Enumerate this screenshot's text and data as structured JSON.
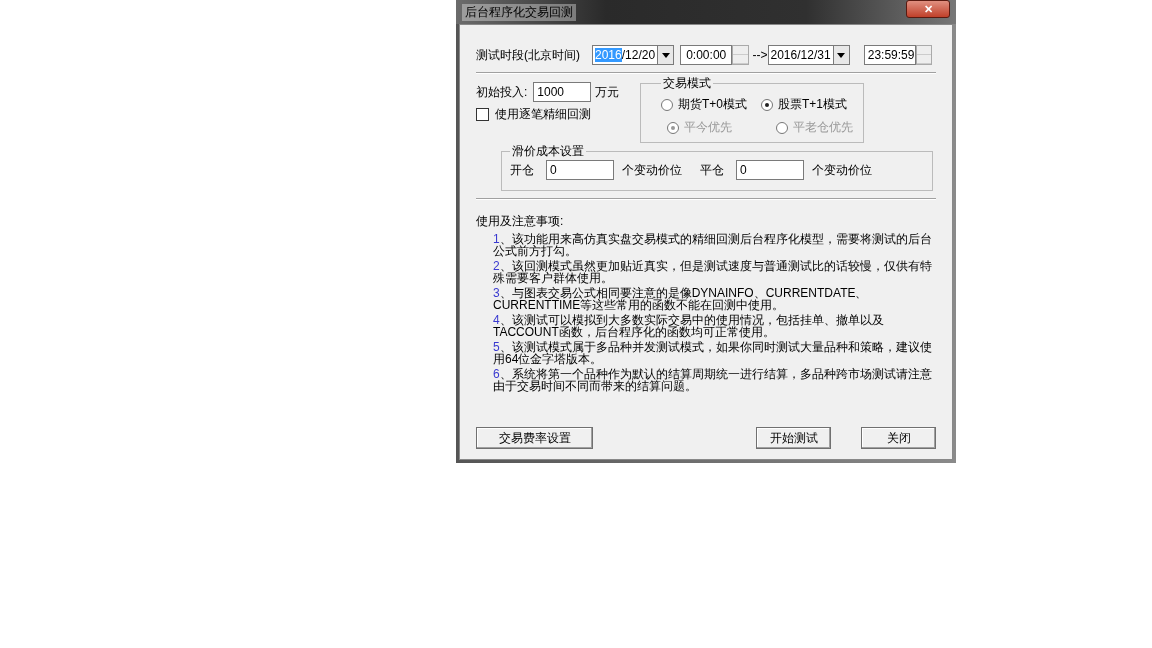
{
  "window": {
    "title": "后台程序化交易回测",
    "close_label": "✕"
  },
  "period": {
    "label": "测试时段(北京时间)",
    "start_date": {
      "selected_text": "2016",
      "rest_text": "/12/20"
    },
    "start_time": "0:00:00",
    "arrow": "-->",
    "end_date": "2016/12/31",
    "end_time": "23:59:59"
  },
  "capital": {
    "label": "初始投入:",
    "value": "1000",
    "unit": "万元"
  },
  "tick_backtest": {
    "label": "使用逐笔精细回测",
    "checked": false
  },
  "trade_mode": {
    "title": "交易模式",
    "modes": [
      {
        "label": "期货T+0模式",
        "selected": false
      },
      {
        "label": "股票T+1模式",
        "selected": true
      }
    ],
    "priorities": [
      {
        "label": "平今优先",
        "selected": true,
        "disabled": true
      },
      {
        "label": "平老仓优先",
        "selected": false,
        "disabled": true
      }
    ]
  },
  "slippage": {
    "title": "滑价成本设置",
    "open_label": "开仓",
    "open_value": "0",
    "open_unit": "个变动价位",
    "close_label": "平仓",
    "close_value": "0",
    "close_unit": "个变动价位"
  },
  "notes": {
    "title": "使用及注意事项:",
    "items": [
      {
        "num": "1",
        "text": "、该功能用来高仿真实盘交易模式的精细回测后台程序化模型，需要将测试的后台公式前方打勾。"
      },
      {
        "num": "2",
        "text": "、该回测模式虽然更加贴近真实，但是测试速度与普通测试比的话较慢，仅供有特殊需要客户群体使用。"
      },
      {
        "num": "3",
        "text": "、与图表交易公式相同要注意的是像DYNAINFO、CURRENTDATE、CURRENTTIME等这些常用的函数不能在回测中使用。"
      },
      {
        "num": "4",
        "text": "、该测试可以模拟到大多数实际交易中的使用情况，包括挂单、撤单以及TACCOUNT函数，后台程序化的函数均可正常使用。"
      },
      {
        "num": "5",
        "text": "、该测试模式属于多品种并发测试模式，如果你同时测试大量品种和策略，建议使用64位金字塔版本。"
      },
      {
        "num": "6",
        "text": "、系统将第一个品种作为默认的结算周期统一进行结算，多品种跨市场测试请注意由于交易时间不同而带来的结算问题。"
      }
    ]
  },
  "buttons": {
    "fee": "交易费率设置",
    "start": "开始测试",
    "close": "关闭"
  }
}
